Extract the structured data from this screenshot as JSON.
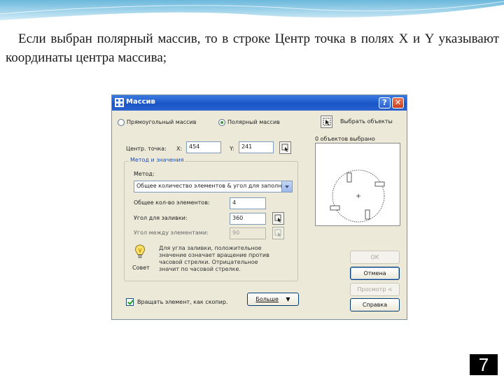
{
  "slide": {
    "text": "Если выбран полярный массив, то в строке Центр точка в полях X и Y указывают координаты центра массива;",
    "page_number": "7",
    "colors": {
      "wave": "#8ecae6",
      "page_badge": "#000000"
    }
  },
  "dialog": {
    "title": "Массив",
    "help_label": "?",
    "close_label": "✕",
    "radio_rectangular": "Прямоугольный массив",
    "radio_polar": "Полярный массив",
    "select_objects": "Выбрать объекты",
    "objects_selected": "0 объектов выбрано",
    "center_label": "Центр. точка:",
    "x_label": "X:",
    "x_value": "454",
    "y_label": "Y:",
    "y_value": "241",
    "group_title": "Метод и значения",
    "method_label": "Метод:",
    "method_value": "Общее количество элементов & угол для заполн",
    "total_items_label": "Общее кол-во элементов:",
    "total_items_value": "4",
    "fill_angle_label": "Угол для заливки:",
    "fill_angle_value": "360",
    "between_angle_label": "Угол между элементами:",
    "between_angle_value": "90",
    "tip_label": "Совет",
    "tip_text": "Для угла заливки, положительное значение означает вращение против часовой стрелки. Отрицательное значит по часовой стрелке.",
    "rotate_label": "Вращать элемент, как скопир.",
    "rotate_checked": true,
    "more_label": "Больше",
    "ok_label": "ОК",
    "cancel_label": "Отмена",
    "preview_label": "Просмотр <",
    "help_button_label": "Справка",
    "colors": {
      "titlebar": "#1a55c6",
      "face": "#ece9d8",
      "accent": "#1c4fc4"
    }
  }
}
